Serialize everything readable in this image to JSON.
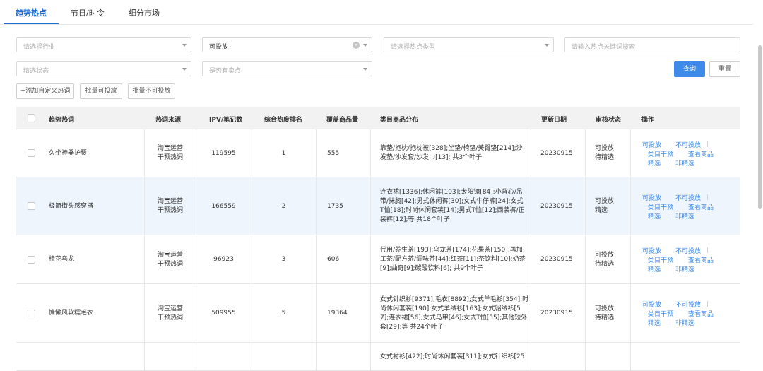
{
  "tabs": [
    {
      "label": "趋势热点",
      "active": true
    },
    {
      "label": "节日/时令",
      "active": false
    },
    {
      "label": "细分市场",
      "active": false
    }
  ],
  "filters": {
    "industry_placeholder": "请选择行业",
    "delivery_value": "可投放",
    "hot_type_placeholder": "请选择热点类型",
    "keyword_placeholder": "请输入热点关键词搜索",
    "select_status_placeholder": "精选状态",
    "has_selling_point_placeholder": "是否有卖点"
  },
  "buttons": {
    "query": "查询",
    "reset": "重置",
    "add_custom": "+添加自定义热词",
    "batch_deliverable": "批量可投放",
    "batch_not_deliverable": "批量不可投放"
  },
  "table": {
    "headers": [
      "趋势热词",
      "热词来源",
      "IPV/笔记数",
      "综合热度排名",
      "覆盖商品量",
      "类目商品分布",
      "更新日期",
      "审核状态",
      "操作"
    ],
    "ops": [
      "可投放",
      "不可投放",
      "类目干预",
      "查看商品",
      "精选",
      "非精选"
    ],
    "rows": [
      {
        "keyword": "久坐神器护腰",
        "source": [
          "淘宝运营",
          "干预热词"
        ],
        "ipv": "119595",
        "rank": "1",
        "cover": "555",
        "dist": [
          "靠垫/抱枕/抱枕被[328];坐垫/椅垫/美臀垫[214];沙",
          "发垫/沙发套/沙发巾[13]; 共3个叶子"
        ],
        "date": "20230915",
        "status": [
          "可投放",
          "待精选"
        ]
      },
      {
        "keyword": "极简街头感穿搭",
        "source": [
          "淘宝运营",
          "干预热词"
        ],
        "ipv": "166559",
        "rank": "2",
        "cover": "1735",
        "dist": [
          "连衣裙[1336];休闲裤[103];太阳镜[84];小背心/吊",
          "带/抹胸[42];男式休闲裤[30];女式牛仔裤[24];女式",
          "T恤[18];时尚休闲套装[14];男式T恤[12];西装裤/正",
          "装裤[12];等 共18个叶子"
        ],
        "date": "20230915",
        "status": [
          "可投放",
          "精选"
        ]
      },
      {
        "keyword": "桂花乌龙",
        "source": [
          "淘宝运营",
          "干预热词"
        ],
        "ipv": "96923",
        "rank": "3",
        "cover": "606",
        "dist": [
          "代用/养生茶[193];乌龙茶[174];花果茶[150];再加",
          "工茶/配方茶/调味茶[44];红茶[11];茶饮料[10];奶茶",
          "[9];曲奇[9];碳酸饮料[6]; 共9个叶子"
        ],
        "date": "20230915",
        "status": [
          "可投放",
          "待精选"
        ]
      },
      {
        "keyword": "慵懒风软糯毛衣",
        "source": [
          "淘宝运营",
          "干预热词"
        ],
        "ipv": "509955",
        "rank": "5",
        "cover": "19364",
        "dist": [
          "女式针织衫[9371];毛衣[8892];女式羊毛衫[354];时",
          "尚休闲套装[190];女式羊绒衫[163];女式貂绒衫[5",
          "7];连衣裙[56];女式马甲[46];女式T恤[35];其他短外",
          "套[29];等 共24个叶子"
        ],
        "date": "20230915",
        "status": [
          "可投放",
          "待精选"
        ]
      },
      {
        "keyword": "",
        "source": [],
        "ipv": "",
        "rank": "",
        "cover": "",
        "dist": [
          "女式衬衫[422];时尚休闲套装[311];女式针织衫[25"
        ],
        "date": "",
        "status": []
      }
    ]
  }
}
